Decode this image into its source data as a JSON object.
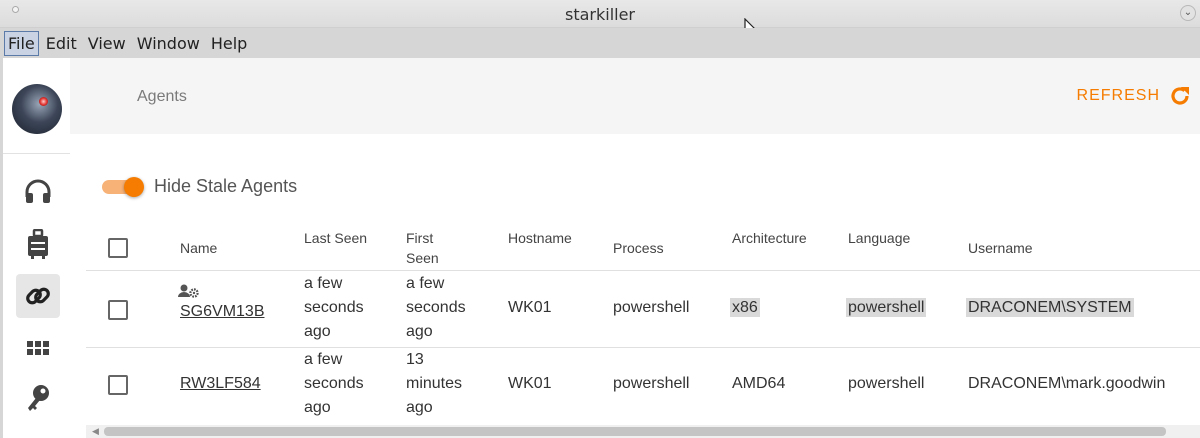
{
  "window": {
    "title": "starkiller"
  },
  "menu": [
    "File",
    "Edit",
    "View",
    "Window",
    "Help"
  ],
  "header": {
    "breadcrumb": "Agents",
    "refresh_label": "REFRESH"
  },
  "nav_icons": [
    "headphones-icon",
    "briefcase-icon",
    "link-icon",
    "apps-grid-icon",
    "key-icon"
  ],
  "toggle": {
    "label": "Hide Stale Agents",
    "on": true
  },
  "columns": {
    "name": "Name",
    "last_seen": "Last Seen",
    "first_seen_1": "First",
    "first_seen_2": "Seen",
    "hostname": "Hostname",
    "process": "Process",
    "architecture": "Architecture",
    "language": "Language",
    "username": "Username"
  },
  "rows": [
    {
      "name": "SG6VM13B",
      "last_seen": [
        "a few",
        "seconds",
        "ago"
      ],
      "first_seen": [
        "a few",
        "seconds",
        "ago"
      ],
      "hostname": "WK01",
      "process": "powershell",
      "architecture": "x86",
      "language": "powershell",
      "username": "DRACONEM\\SYSTEM"
    },
    {
      "name": "RW3LF584",
      "last_seen": [
        "a few",
        "seconds",
        "ago"
      ],
      "first_seen": [
        "13",
        "minutes",
        "ago"
      ],
      "hostname": "WK01",
      "process": "powershell",
      "architecture": "AMD64",
      "language": "powershell",
      "username": "DRACONEM\\mark.goodwin"
    }
  ],
  "colors": {
    "accent": "#f57c00",
    "accent_light": "#f7b278",
    "highlight": "#d9d9d9"
  }
}
